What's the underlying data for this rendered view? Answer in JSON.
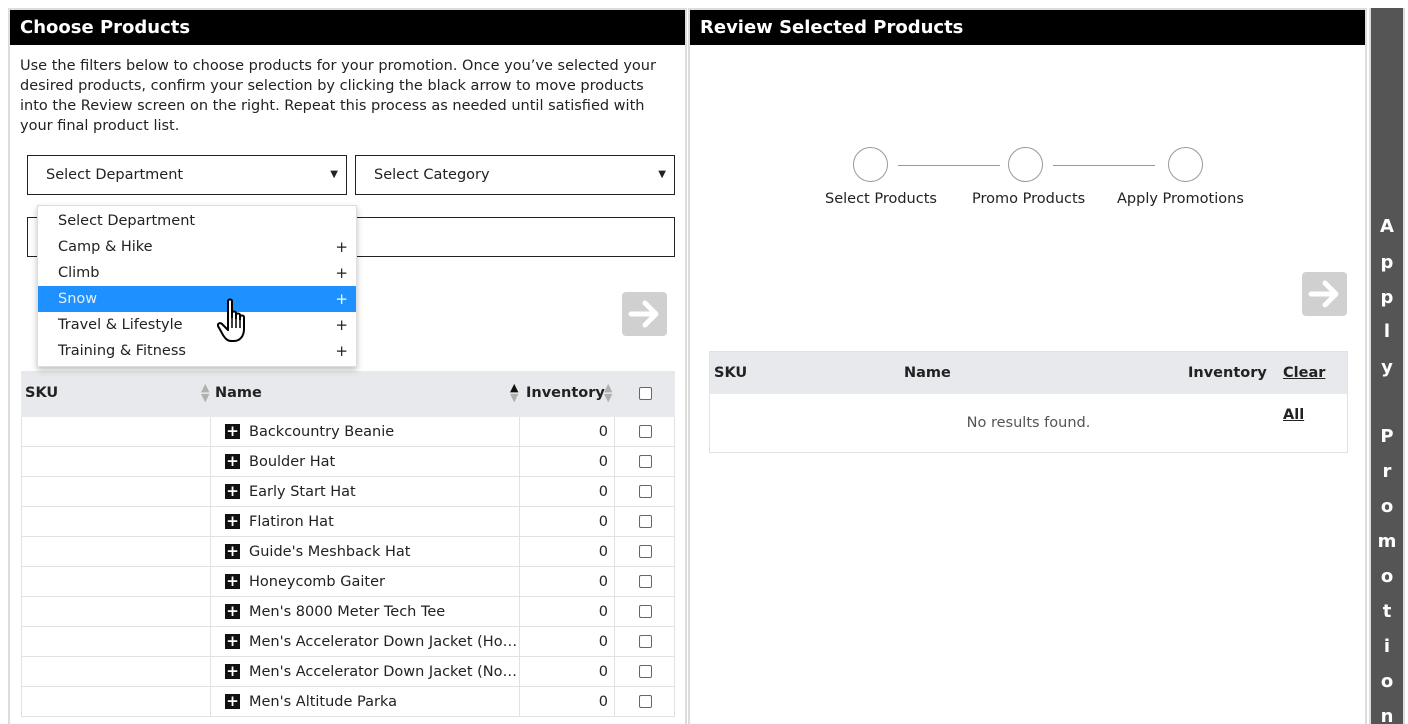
{
  "left_panel": {
    "title": "Choose Products",
    "intro": "Use the filters below to choose products for your promotion. Once you’ve selected your desired products, confirm your selection by clicking the black arrow to move products into the Review screen on the right. Repeat this process as needed until satisfied with your final product list.",
    "department_select": {
      "value": "Select Department",
      "caret": "▼"
    },
    "category_select": {
      "value": "Select Category",
      "caret": "▼"
    },
    "move_arrow_icon": "arrow-right-icon",
    "department_options": [
      {
        "label": "Select Department",
        "expandable": false,
        "selected": false
      },
      {
        "label": "Camp & Hike",
        "expandable": true,
        "selected": false
      },
      {
        "label": "Climb",
        "expandable": true,
        "selected": false
      },
      {
        "label": "Snow",
        "expandable": true,
        "selected": true
      },
      {
        "label": "Travel & Lifestyle",
        "expandable": true,
        "selected": false
      },
      {
        "label": "Training & Fitness",
        "expandable": true,
        "selected": false
      }
    ],
    "table": {
      "columns": {
        "sku": "SKU",
        "name": "Name",
        "inventory": "Inventory"
      },
      "rows": [
        {
          "sku": "",
          "name": "Backcountry Beanie",
          "inventory": "0"
        },
        {
          "sku": "",
          "name": "Boulder Hat",
          "inventory": "0"
        },
        {
          "sku": "",
          "name": "Early Start Hat",
          "inventory": "0"
        },
        {
          "sku": "",
          "name": "Flatiron Hat",
          "inventory": "0"
        },
        {
          "sku": "",
          "name": "Guide's Meshback Hat",
          "inventory": "0"
        },
        {
          "sku": "",
          "name": "Honeycomb Gaiter",
          "inventory": "0"
        },
        {
          "sku": "",
          "name": "Men's 8000 Meter Tech Tee",
          "inventory": "0"
        },
        {
          "sku": "",
          "name": "Men's Accelerator Down Jacket (Hoo...",
          "inventory": "0"
        },
        {
          "sku": "",
          "name": "Men's Accelerator Down Jacket (Non...",
          "inventory": "0"
        },
        {
          "sku": "",
          "name": "Men's Altitude Parka",
          "inventory": "0"
        }
      ]
    }
  },
  "right_panel": {
    "title": "Review Selected Products",
    "steps": [
      "Select Products",
      "Promo Products",
      "Apply Promotions"
    ],
    "table": {
      "columns": {
        "sku": "SKU",
        "name": "Name",
        "inventory": "Inventory",
        "clear_all": "Clear All"
      },
      "empty_message": "No results found."
    }
  },
  "apply_bar": {
    "label": "Apply Promotion",
    "chars": [
      "A",
      "p",
      "p",
      "l",
      "y",
      "",
      "P",
      "r",
      "o",
      "m",
      "o",
      "t",
      "i",
      "o",
      "n"
    ]
  },
  "colors": {
    "header_bg": "#000000",
    "dropdown_selected": "#1e90ff",
    "apply_bar_bg": "#555555",
    "arrow_button_bg": "#d0d0d0"
  }
}
